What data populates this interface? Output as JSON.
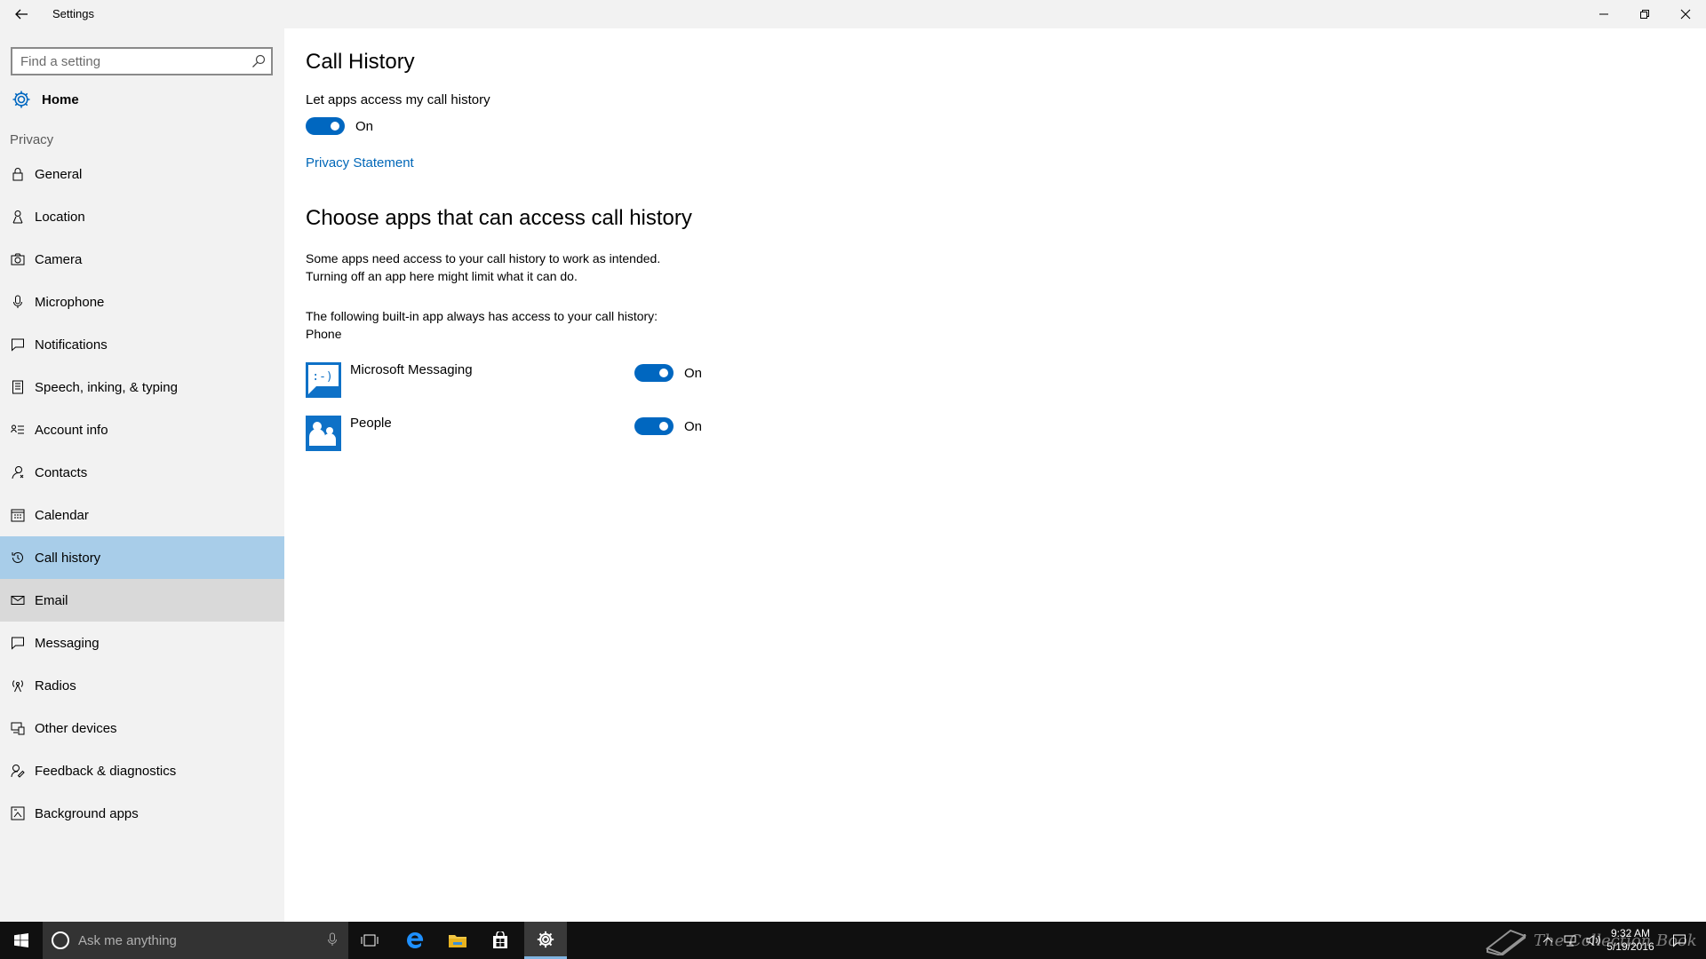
{
  "window": {
    "title": "Settings",
    "back_icon": "back-arrow-icon",
    "controls": [
      "minimize-icon",
      "maximize-icon",
      "close-icon"
    ]
  },
  "sidebar": {
    "search_placeholder": "Find a setting",
    "home_label": "Home",
    "section_label": "Privacy",
    "items": [
      {
        "label": "General",
        "icon": "lock-icon"
      },
      {
        "label": "Location",
        "icon": "location-icon"
      },
      {
        "label": "Camera",
        "icon": "camera-icon"
      },
      {
        "label": "Microphone",
        "icon": "microphone-icon"
      },
      {
        "label": "Notifications",
        "icon": "notifications-icon"
      },
      {
        "label": "Speech, inking, & typing",
        "icon": "speech-icon"
      },
      {
        "label": "Account info",
        "icon": "account-info-icon"
      },
      {
        "label": "Contacts",
        "icon": "contacts-icon"
      },
      {
        "label": "Calendar",
        "icon": "calendar-icon"
      },
      {
        "label": "Call history",
        "icon": "call-history-icon",
        "state": "selected"
      },
      {
        "label": "Email",
        "icon": "email-icon",
        "state": "hover"
      },
      {
        "label": "Messaging",
        "icon": "messaging-icon"
      },
      {
        "label": "Radios",
        "icon": "radios-icon"
      },
      {
        "label": "Other devices",
        "icon": "other-devices-icon"
      },
      {
        "label": "Feedback & diagnostics",
        "icon": "feedback-icon"
      },
      {
        "label": "Background apps",
        "icon": "background-apps-icon"
      }
    ]
  },
  "main": {
    "title": "Call History",
    "setting_label": "Let apps access my call history",
    "master_toggle_state": "On",
    "privacy_link": "Privacy Statement",
    "section_title": "Choose apps that can access call history",
    "description_line1": "Some apps need access to your call history to work as intended.",
    "description_line2": "Turning off an app here might limit what it can do.",
    "builtin_line1": "The following built-in app always has access to your call history:",
    "builtin_line2": "Phone",
    "apps": [
      {
        "name": "Microsoft Messaging",
        "state": "On",
        "icon": "messaging-app-icon",
        "icon_text": ":-)"
      },
      {
        "name": "People",
        "state": "On",
        "icon": "people-app-icon"
      }
    ]
  },
  "taskbar": {
    "search_placeholder": "Ask me anything",
    "time": "9:32 AM",
    "date": "5/19/2016",
    "watermark": "The Collection Book"
  },
  "colors": {
    "accent": "#0067c0",
    "selected": "#a8cde9",
    "hover": "#d9d9d9",
    "sidebar_bg": "#f2f2f2",
    "link": "#0067b8"
  }
}
